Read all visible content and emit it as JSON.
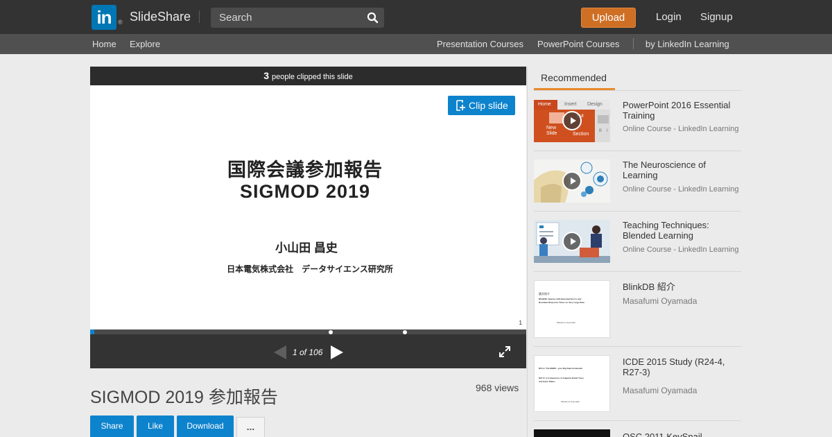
{
  "header": {
    "logo_text": "in",
    "logo_reg": "®",
    "brand": "SlideShare",
    "search_placeholder": "Search",
    "upload_label": "Upload",
    "login_label": "Login",
    "signup_label": "Signup"
  },
  "subnav": {
    "left": [
      "Home",
      "Explore"
    ],
    "right": [
      "Presentation Courses",
      "PowerPoint Courses",
      "by LinkedIn Learning"
    ]
  },
  "player": {
    "clip_count": "3",
    "clip_text": "people clipped this slide",
    "clip_button": "Clip slide",
    "slide_title_line1": "国際会議参加報告",
    "slide_title_line2": "SIGMOD 2019",
    "slide_author": "小山田 昌史",
    "slide_affiliation": "日本電気株式会社　データサイエンス研究所",
    "slide_page_number": "1",
    "page_indicator": "1 of 106",
    "current_slide": 1,
    "total_slides": 106
  },
  "presentation": {
    "title": "SIGMOD 2019 参加報告",
    "views": "968 views",
    "actions": [
      "Share",
      "Like",
      "Download"
    ],
    "more_label": "..."
  },
  "sidebar": {
    "tab_label": "Recommended",
    "items": [
      {
        "title": "PowerPoint 2016 Essential Training",
        "subtitle": "Online Course - LinkedIn Learning",
        "thumb_texts": [
          "Home",
          "Insert",
          "Design",
          "New",
          "Slide",
          "out",
          "Section",
          "B",
          "I"
        ]
      },
      {
        "title": "The Neuroscience of Learning",
        "subtitle": "Online Course - LinkedIn Learning"
      },
      {
        "title": "Teaching Techniques: Blended Learning",
        "subtitle": "Online Course - LinkedIn Learning"
      },
      {
        "title": "BlinkDB 紹介",
        "subtitle": "Masafumi Oyamada",
        "thumb_texts": [
          "論文紹介",
          "BlinkDB: Queries with Bounded Errors and",
          "Bounded Response Times on Very Large Data",
          "Masafumi Oyamada"
        ]
      },
      {
        "title": "ICDE 2015 Study (R24-4, R27-3)",
        "subtitle": "Masafumi Oyamada",
        "thumb_texts": [
          "R24-4: The DBMS - your Big Data Sommelier",
          "R27-3: A Comparison of Adaptive Radix Trees",
          "and Hash Tables",
          "Masafumi Oyamada"
        ]
      },
      {
        "title": "OSC 2011 KeySnail",
        "subtitle": ""
      }
    ]
  },
  "colors": {
    "header_bg": "#333333",
    "subnav_bg": "#505050",
    "upload_orange": "#ce6f24",
    "accent_blue": "#0e83cd",
    "tab_underline": "#e8892c",
    "linkedin_blue": "#0077b5"
  },
  "icons": [
    "search-icon",
    "clip-icon",
    "play-icon",
    "fullscreen-icon",
    "prev-arrow-icon",
    "next-arrow-icon",
    "more-icon"
  ]
}
